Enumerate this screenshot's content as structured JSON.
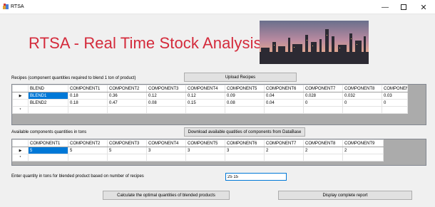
{
  "window": {
    "title": "RTSA",
    "minimize": "—",
    "close": "✕",
    "app_icon": "app-icon"
  },
  "heading": "RTSA - Real Time Stock Analysis",
  "recipes": {
    "label": "Recipes (component quantities required to blend 1 ton of product)",
    "upload_button": "Upload Recipes",
    "columns": [
      "BLEND",
      "COMPONENT1",
      "COMPONENT2",
      "COMPONENT3",
      "COMPONENT4",
      "COMPONENT5",
      "COMPONENT6",
      "COMPONENT7",
      "COMPONENT8",
      "COMPONENT9"
    ],
    "rows": [
      {
        "marker": "▶",
        "cells": [
          "BLEND1",
          "0.18",
          "0.36",
          "0.12",
          "0.12",
          "0.09",
          "0.04",
          "0.028",
          "0.032",
          "0.03"
        ]
      },
      {
        "marker": "",
        "cells": [
          "BLEND2",
          "0.18",
          "0.47",
          "0.08",
          "0.15",
          "0.08",
          "0.04",
          "0",
          "0",
          "0"
        ]
      }
    ],
    "new_row_marker": "*"
  },
  "components": {
    "label": "Available components quantities in tons",
    "download_button": "Download available quatities of components from DataBase",
    "columns": [
      "COMPONENT1",
      "COMPONENT2",
      "COMPONENT3",
      "COMPONENT4",
      "COMPONENT5",
      "COMPONENT6",
      "COMPONENT7",
      "COMPONENT8",
      "COMPONENT9"
    ],
    "rows": [
      {
        "marker": "▶",
        "cells": [
          "5",
          "5",
          "5",
          "3",
          "3",
          "3",
          "2",
          "2",
          "2"
        ]
      }
    ],
    "new_row_marker": "*"
  },
  "quantity": {
    "label": "Enter quantity in tons for blended product based on number of recipes",
    "value": "25 15"
  },
  "calculate_button": "Calculate the optimal quantities of blended products",
  "report_button": "Display complete report",
  "colors": {
    "heading": "#d42a3b",
    "selection": "#0078d7"
  }
}
